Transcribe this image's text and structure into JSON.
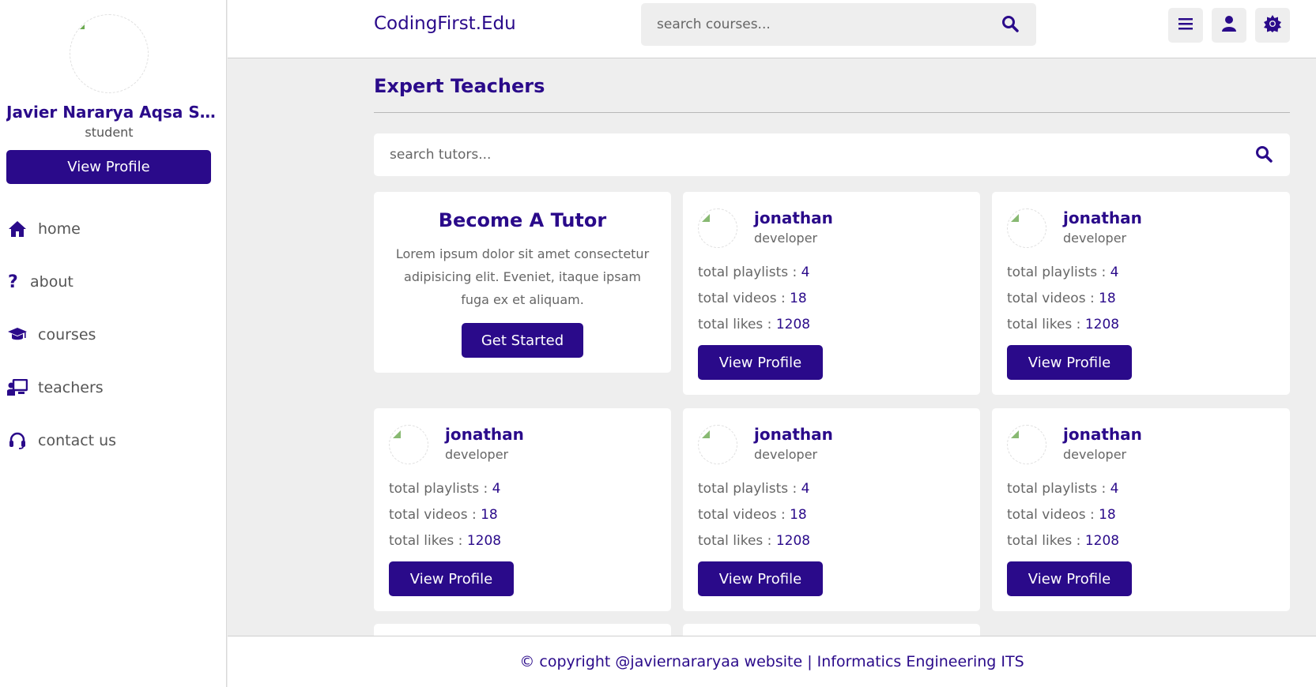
{
  "sidebar": {
    "user_name": "Javier Nararya Aqsa Setiy...",
    "user_role": "student",
    "profile_button": "View Profile",
    "nav": [
      {
        "label": "home",
        "icon": "home-icon"
      },
      {
        "label": "about",
        "icon": "question-icon"
      },
      {
        "label": "courses",
        "icon": "graduation-cap-icon"
      },
      {
        "label": "teachers",
        "icon": "chalkboard-teacher-icon"
      },
      {
        "label": "contact us",
        "icon": "headset-icon"
      }
    ]
  },
  "header": {
    "logo": "CodingFirst.Edu",
    "search_placeholder": "search courses..."
  },
  "main": {
    "heading": "Expert Teachers",
    "tutor_search_placeholder": "search tutors...",
    "become": {
      "title": "Become A Tutor",
      "description": "Lorem ipsum dolor sit amet consectetur adipisicing elit. Eveniet, itaque ipsam fuga ex et aliquam.",
      "button": "Get Started"
    },
    "stat_labels": {
      "playlists": "total playlists : ",
      "videos": "total videos : ",
      "likes": "total likes : "
    },
    "tutors": [
      {
        "name": "jonathan",
        "role": "developer",
        "playlists": "4",
        "videos": "18",
        "likes": "1208",
        "button": "View Profile"
      },
      {
        "name": "jonathan",
        "role": "developer",
        "playlists": "4",
        "videos": "18",
        "likes": "1208",
        "button": "View Profile"
      },
      {
        "name": "jonathan",
        "role": "developer",
        "playlists": "4",
        "videos": "18",
        "likes": "1208",
        "button": "View Profile"
      },
      {
        "name": "jonathan",
        "role": "developer",
        "playlists": "4",
        "videos": "18",
        "likes": "1208",
        "button": "View Profile"
      },
      {
        "name": "jonathan",
        "role": "developer",
        "playlists": "4",
        "videos": "18",
        "likes": "1208",
        "button": "View Profile"
      }
    ]
  },
  "footer": {
    "text": "© copyright @javiernararyaa website | Informatics Engineering ITS"
  },
  "colors": {
    "accent": "#2a0a8a",
    "background": "#eeeeee",
    "card": "#ffffff",
    "muted_text": "#666666"
  }
}
